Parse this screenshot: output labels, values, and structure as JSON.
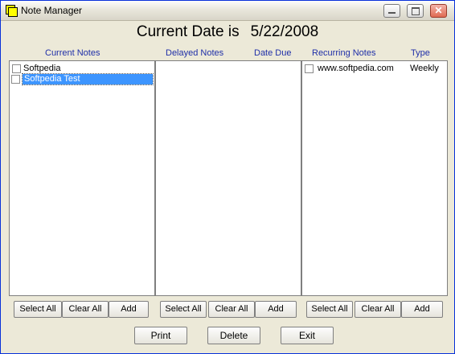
{
  "window": {
    "title": "Note Manager"
  },
  "header": {
    "label": "Current Date is",
    "date": "5/22/2008"
  },
  "current_notes": {
    "header": "Current Notes",
    "items": [
      {
        "label": "Softpedia",
        "checked": false,
        "selected": false
      },
      {
        "label": "Softpedia Test",
        "checked": false,
        "selected": true
      }
    ],
    "buttons": {
      "select_all": "Select All",
      "clear_all": "Clear All",
      "add": "Add"
    }
  },
  "delayed_notes": {
    "header": "Delayed Notes",
    "date_header": "Date Due",
    "items": [],
    "buttons": {
      "select_all": "Select All",
      "clear_all": "Clear All",
      "add": "Add"
    }
  },
  "recurring_notes": {
    "header": "Recurring Notes",
    "type_header": "Type",
    "items": [
      {
        "label": "www.softpedia.com",
        "type": "Weekly",
        "checked": false
      }
    ],
    "buttons": {
      "select_all": "Select All",
      "clear_all": "Clear All",
      "add": "Add"
    }
  },
  "footer": {
    "print": "Print",
    "delete": "Delete",
    "exit": "Exit"
  },
  "icons": {
    "app": "notes-app-icon",
    "minimize": "minimize-icon",
    "maximize": "maximize-icon",
    "close": "close-icon"
  },
  "colors": {
    "header_text": "#1f2fa8",
    "selection": "#3d95ff"
  }
}
